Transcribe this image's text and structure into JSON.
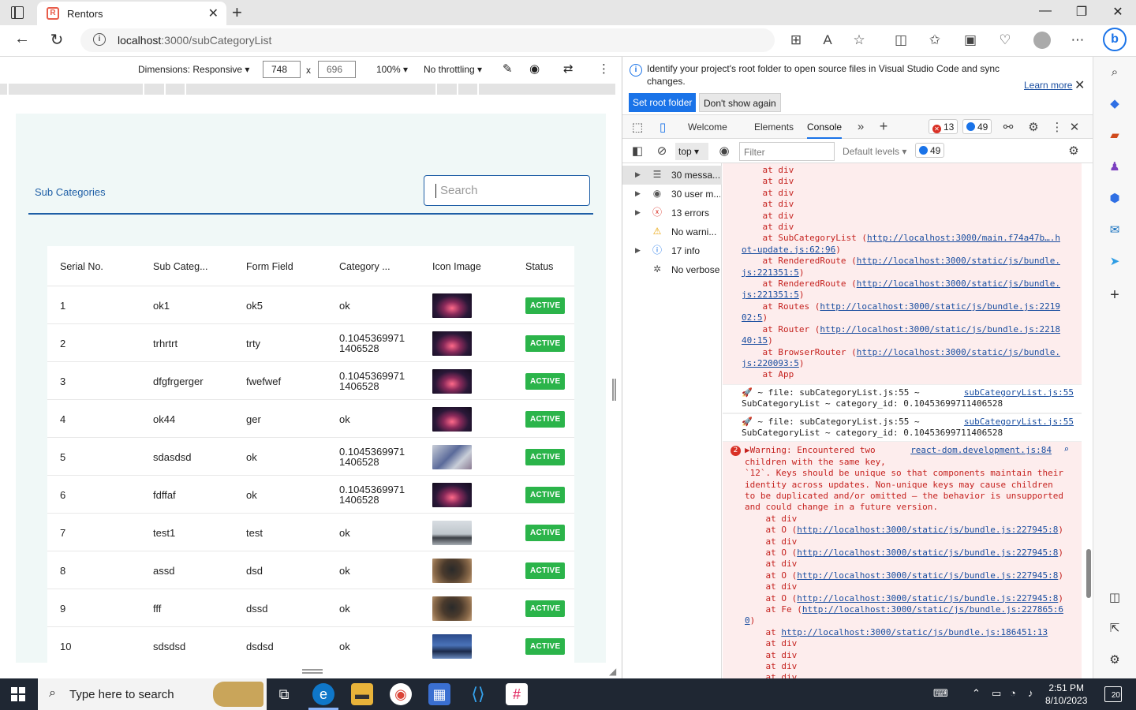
{
  "browser": {
    "tab_title": "Rentors",
    "tab_favicon": "R",
    "url_host": "localhost",
    "url_path": ":3000/subCategoryList"
  },
  "device_toolbar": {
    "dimensions_label": "Dimensions: Responsive",
    "width": "748",
    "height": "696",
    "times": "x",
    "zoom": "100%",
    "throttling": "No throttling"
  },
  "page": {
    "title": "Sub Categories",
    "search_placeholder": "Search",
    "columns": [
      "Serial No.",
      "Sub Categ...",
      "Form Field",
      "Category ...",
      "Icon Image",
      "Status"
    ],
    "rows": [
      {
        "serial": "1",
        "sub": "ok1",
        "form": "ok5",
        "cat": "ok",
        "cat2": "",
        "img": "sunset-tree",
        "status": "ACTIVE"
      },
      {
        "serial": "2",
        "sub": "trhrtrt",
        "form": "trty",
        "cat": "0.1045369971",
        "cat2": "1406528",
        "img": "sunset-tree",
        "status": "ACTIVE"
      },
      {
        "serial": "3",
        "sub": "dfgfrgerger",
        "form": "fwefwef",
        "cat": "0.1045369971",
        "cat2": "1406528",
        "img": "sunset-tree",
        "status": "ACTIVE"
      },
      {
        "serial": "4",
        "sub": "ok44",
        "form": "ger",
        "cat": "ok",
        "cat2": "",
        "img": "sunset-tree",
        "status": "ACTIVE"
      },
      {
        "serial": "5",
        "sub": "sdasdsd",
        "form": "ok",
        "cat": "0.1045369971",
        "cat2": "1406528",
        "img": "card-photo",
        "status": "ACTIVE"
      },
      {
        "serial": "6",
        "sub": "fdffaf",
        "form": "ok",
        "cat": "0.1045369971",
        "cat2": "1406528",
        "img": "sunset-tree",
        "status": "ACTIVE"
      },
      {
        "serial": "7",
        "sub": "test1",
        "form": "test",
        "cat": "ok",
        "cat2": "",
        "img": "foggy-car",
        "status": "ACTIVE"
      },
      {
        "serial": "8",
        "sub": "assd",
        "form": "dsd",
        "cat": "ok",
        "cat2": "",
        "img": "photographer",
        "status": "ACTIVE"
      },
      {
        "serial": "9",
        "sub": "fff",
        "form": "dssd",
        "cat": "ok",
        "cat2": "",
        "img": "photographer",
        "status": "ACTIVE"
      },
      {
        "serial": "10",
        "sub": "sdsdsd",
        "form": "dsdsd",
        "cat": "ok",
        "cat2": "",
        "img": "night-road",
        "status": "ACTIVE"
      }
    ]
  },
  "devtools": {
    "info_text": "Identify your project's root folder to open source files in Visual Studio Code and sync changes.",
    "learn_more": "Learn more",
    "set_root": "Set root folder",
    "dont_show": "Don't show again",
    "tabs": [
      "Welcome",
      "Elements",
      "Console"
    ],
    "error_count": "13",
    "info_count": "49",
    "context": "top",
    "filter_placeholder": "Filter",
    "levels": "Default levels",
    "levels_count": "49",
    "sidebar": [
      {
        "label": "30 messa...",
        "icon": "list-icon",
        "arrow": true
      },
      {
        "label": "30 user m...",
        "icon": "user-icon",
        "arrow": true
      },
      {
        "label": "13 errors",
        "icon": "error-icon",
        "arrow": true
      },
      {
        "label": "No warni...",
        "icon": "warning-icon",
        "arrow": false
      },
      {
        "label": "17 info",
        "icon": "info-icon",
        "arrow": true
      },
      {
        "label": "No verbose",
        "icon": "bug-icon",
        "arrow": false
      }
    ],
    "log": {
      "top_lines": [
        "at div",
        "at div",
        "at div",
        "at div",
        "at div",
        "at div"
      ],
      "stack1": [
        {
          "pre": "at SubCategoryList (",
          "link": "http://localhost:3000/main.f74a47b….h",
          "cont": "ot-update.js:62:96",
          "post": ")"
        },
        {
          "pre": "at RenderedRoute (",
          "link": "http://localhost:3000/static/js/bundle.",
          "cont": "js:221351:5",
          "post": ")"
        },
        {
          "pre": "at RenderedRoute (",
          "link": "http://localhost:3000/static/js/bundle.",
          "cont": "js:221351:5",
          "post": ")"
        },
        {
          "pre": "at Routes (",
          "link": "http://localhost:3000/static/js/bundle.js:2219",
          "cont": "02:5",
          "post": ")"
        },
        {
          "pre": "at Router (",
          "link": "http://localhost:3000/static/js/bundle.js:2218",
          "cont": "40:15",
          "post": ")"
        },
        {
          "pre": "at BrowserRouter (",
          "link": "http://localhost:3000/static/js/bundle.",
          "cont": "js:220093:5",
          "post": ")"
        }
      ],
      "at_app": "at App",
      "file_msg_1": "~ file: subCategoryList.js:55 ~",
      "file_msg_2": "SubCategoryList ~ category_id: 0.10453699711406528",
      "file_src": "subCategoryList.js:55",
      "warn_count": "2",
      "warn_src": "react-dom.development.js:84",
      "warn_lines": [
        "Warning: Encountered two",
        "children with the same key,",
        "`12`. Keys should be unique so that components maintain their",
        "identity across updates. Non-unique keys may cause children",
        "to be duplicated and/or omitted — the behavior is unsupported",
        "and could change in a future version."
      ],
      "o_link": "http://localhost:3000/static/js/bundle.js:227945:8",
      "fe_link": "http://localhost:3000/static/js/bundle.js:227865:6",
      "fe_cont": "0",
      "anon_link": "http://localhost:3000/static/js/bundle.js:186451:13",
      "at_div": "at div",
      "at_o": "at O (",
      "at_fe": "at Fe (",
      "at_": "at "
    }
  },
  "taskbar": {
    "search_text": "Type here to search",
    "time": "2:51 PM",
    "date": "8/10/2023",
    "notifications": "20"
  }
}
